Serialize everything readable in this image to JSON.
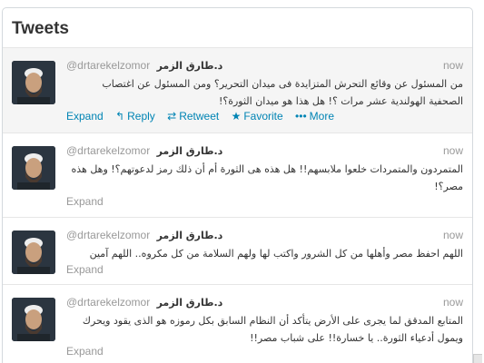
{
  "panel": {
    "title": "Tweets"
  },
  "tweets": [
    {
      "handle": "@drtarekelzomor",
      "name": "د.طارق الزمر",
      "time": "now",
      "text": "من المسئول عن وقائع التحرش المتزايدة فى ميدان التحرير؟ ومن المسئول عن اغتصاب الصحفية الهولندية عشر مرات ؟! هل هذا هو ميدان الثورة؟!",
      "actions": {
        "expand": "Expand",
        "reply": "Reply",
        "retweet": "Retweet",
        "favorite": "Favorite",
        "more": "More"
      }
    },
    {
      "handle": "@drtarekelzomor",
      "name": "د.طارق الزمر",
      "time": "now",
      "text": "المتمردون والمتمردات خلعوا ملابسهم!! هل هذه هى الثورة أم أن ذلك رمز لدعوتهم؟! وهل هذه مصر؟!",
      "actions": {
        "expand": "Expand"
      }
    },
    {
      "handle": "@drtarekelzomor",
      "name": "د.طارق الزمر",
      "time": "now",
      "text": "اللهم احفظ مصر وأهلها من كل الشرور واكتب لها ولهم السلامة من كل مكروه.. اللهم آمين",
      "actions": {
        "expand": "Expand"
      }
    },
    {
      "handle": "@drtarekelzomor",
      "name": "د.طارق الزمر",
      "time": "now",
      "text": "المتابع المدقق لما يجرى على الأرض يتأكد أن النظام السابق بكل رموزه هو الذى يقود ويحرك ويمول أدعياء الثورة.. يا خسارة!! على شباب مصر!!",
      "actions": {
        "expand": "Expand"
      }
    }
  ]
}
